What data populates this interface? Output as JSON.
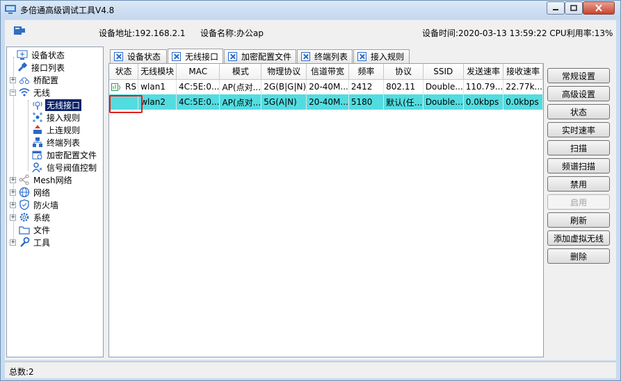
{
  "app": {
    "title": "多倍通高级调试工具V4.8"
  },
  "info": {
    "device_address": "设备地址:192.168.2.1",
    "device_name": "设备名称:办公ap",
    "device_time_cpu": "设备时间:2020-03-13 13:59:22 CPU利用率:13%"
  },
  "tree": {
    "items": [
      {
        "label": "设备状态",
        "icon": "monitor-icon"
      },
      {
        "label": "接口列表",
        "icon": "plug-icon"
      },
      {
        "label": "桥配置",
        "icon": "bridge-icon"
      },
      {
        "label": "无线",
        "icon": "wifi-icon"
      },
      {
        "label": "无线接口",
        "icon": "wireless-interface-icon"
      },
      {
        "label": "接入规则",
        "icon": "access-rule-icon"
      },
      {
        "label": "上连规则",
        "icon": "uplink-rule-icon"
      },
      {
        "label": "终端列表",
        "icon": "terminal-list-icon"
      },
      {
        "label": "加密配置文件",
        "icon": "encryption-profile-icon"
      },
      {
        "label": "信号阀值控制",
        "icon": "signal-threshold-icon"
      },
      {
        "label": "Mesh网络",
        "icon": "mesh-icon"
      },
      {
        "label": "网络",
        "icon": "globe-icon"
      },
      {
        "label": "防火墙",
        "icon": "shield-icon"
      },
      {
        "label": "系统",
        "icon": "gear-icon"
      },
      {
        "label": "文件",
        "icon": "folder-icon"
      },
      {
        "label": "工具",
        "icon": "wrench-icon"
      }
    ]
  },
  "tabs": [
    "设备状态",
    "无线接口",
    "加密配置文件",
    "终端列表",
    "接入规则"
  ],
  "table": {
    "headers": [
      "状态",
      "无线模块",
      "MAC",
      "模式",
      "物理协议",
      "信道带宽",
      "频率",
      "协议",
      "SSID",
      "发送速率",
      "接收速率"
    ],
    "rows": [
      [
        "RS",
        "wlan1",
        "4C:5E:0...",
        "AP(点对...",
        "2G(B|G|N)",
        "20-40M...",
        "2412",
        "802.11",
        "Double...",
        "110.79...",
        "22.77k..."
      ],
      [
        "",
        "wlan2",
        "4C:5E:0...",
        "AP(点对...",
        "5G(A|N)",
        "20-40M...",
        "5180",
        "默认(任...",
        "Double...",
        "0.0kbps",
        "0.0kbps"
      ]
    ]
  },
  "buttons": {
    "general_settings": "常规设置",
    "advanced_settings": "高级设置",
    "status": "状态",
    "realtime_rate": "实时速率",
    "scan": "扫描",
    "spectrum_scan": "频谱扫描",
    "disable": "禁用",
    "enable": "启用",
    "refresh": "刷新",
    "add_virtual_wireless": "添加虚拟无线",
    "delete": "删除"
  },
  "statusbar": {
    "count": "总数:2"
  },
  "colors": {
    "selected_row": "#53dce0",
    "highlight_box": "#e0201a",
    "tree_selection": "#0a246a"
  }
}
